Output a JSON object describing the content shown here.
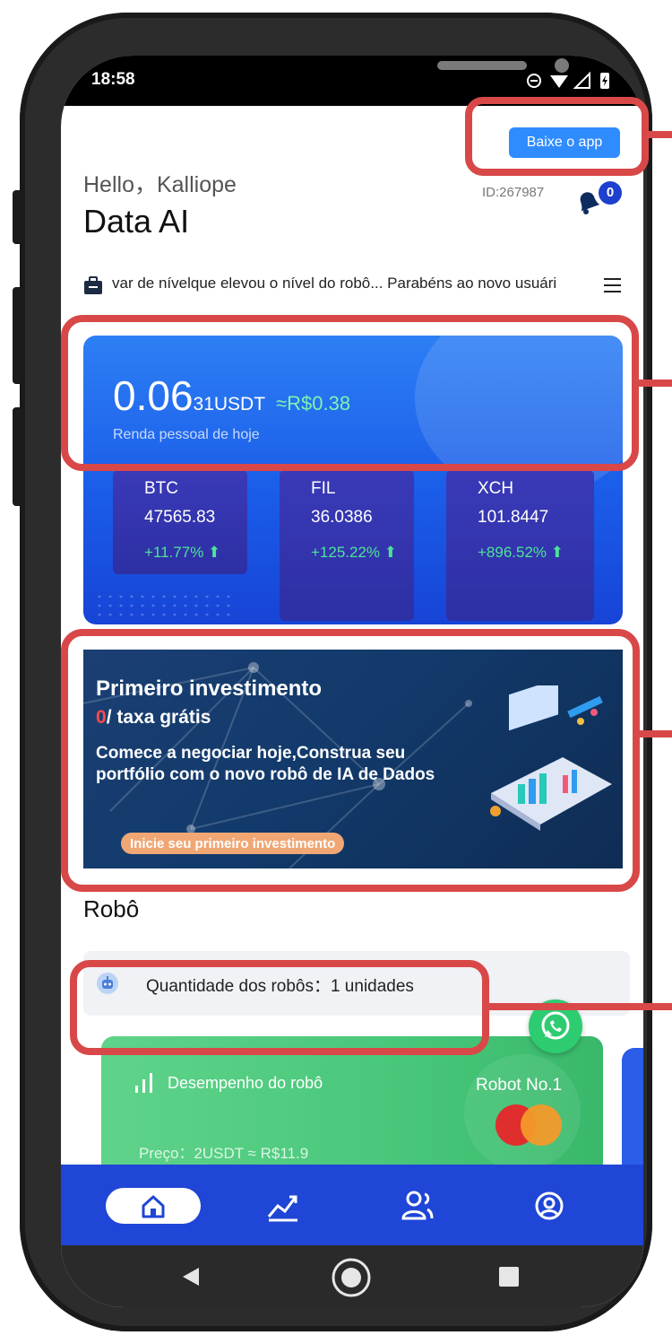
{
  "status_bar": {
    "time": "18:58",
    "icons": [
      "do-not-disturb-icon",
      "wifi-icon",
      "signal-icon",
      "battery-icon"
    ]
  },
  "header": {
    "download_button": "Baixe o app",
    "greeting": "Hello，Kalliope",
    "app_title": "Data AI",
    "user_id": "ID:267987",
    "notification_count": "0"
  },
  "notice": {
    "text": "var de nívelque elevou o nível do robô... Parabéns ao novo usuári"
  },
  "income": {
    "value_main": "0.06",
    "value_small": "31USDT",
    "value_brl": "≈R$0.38",
    "label": "Renda pessoal de hoje"
  },
  "tickers": [
    {
      "name": "BTC",
      "price": "47565.83",
      "change": "+11.77% ⬆"
    },
    {
      "name": "FIL",
      "price": "36.0386",
      "change": "+125.22% ⬆"
    },
    {
      "name": "XCH",
      "price": "101.8447",
      "change": "+896.52% ⬆"
    }
  ],
  "banner": {
    "title": "Primeiro investimento",
    "sub_zero": "0",
    "sub_rest": "/ taxa grátis",
    "description": "Comece a negociar hoje,Construa seu portfólio com o novo robô de IA de Dados",
    "cta": "Inicie seu primeiro investimento"
  },
  "robots": {
    "section_title": "Robô",
    "count_text": "Quantidade dos robôs：1 unidades",
    "card": {
      "performance_label": "Desempenho do robô",
      "name": "Robot No.1",
      "price": "Preço：2USDT ≈ R$11.9"
    }
  },
  "bottom_nav": {
    "items": [
      "home-icon",
      "chart-icon",
      "team-icon",
      "profile-icon"
    ],
    "active": "home"
  },
  "colors": {
    "brand_blue": "#1f46d6",
    "card_blue": "#2d7ff5",
    "accent_green": "#4ee39a",
    "robot_green": "#48c77a",
    "badge_zero_red": "#ff4a4a"
  }
}
